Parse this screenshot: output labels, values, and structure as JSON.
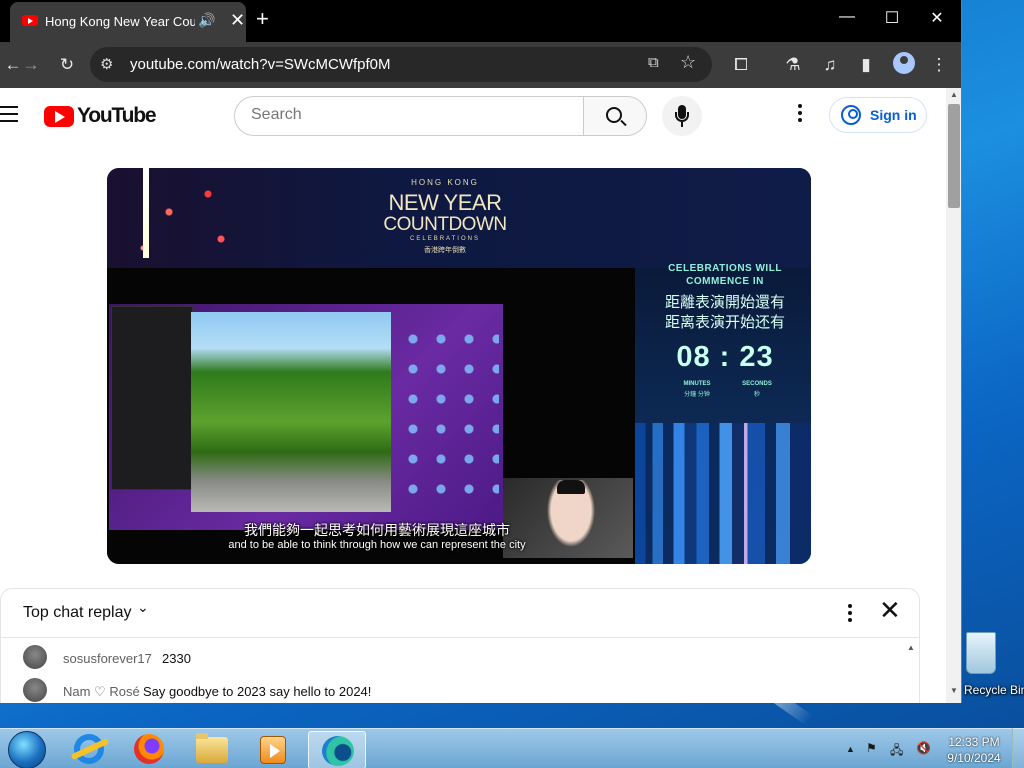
{
  "desktop": {
    "recycle_bin_label": "Recycle Bin"
  },
  "browser": {
    "tab_title": "Hong Kong New Year Countdown",
    "url": "youtube.com/watch?v=SWcMCWfpf0M",
    "new_tab_glyph": "+",
    "controls": {
      "minimize": "—",
      "maximize": "☐",
      "close": "✕"
    },
    "icons": [
      "back-icon",
      "forward-icon",
      "reload-icon",
      "tune-icon",
      "cast-icon",
      "star-icon",
      "extensions-icon",
      "labs-icon",
      "media-icon",
      "sidepanel-icon",
      "profile-icon",
      "menu-icon"
    ]
  },
  "youtube": {
    "logo_text": "YouTube",
    "search_placeholder": "Search",
    "sign_in_label": "Sign in"
  },
  "video": {
    "brand_top": "HONG KONG",
    "brand_line1": "NEW YEAR",
    "brand_line2": "COUNTDOWN",
    "brand_sub": "CELEBRATIONS",
    "brand_zh": "香港跨年倒數",
    "countdown_en1": "CELEBRATIONS WILL",
    "countdown_en2": "COMMENCE IN",
    "countdown_zh_trad": "距離表演開始還有",
    "countdown_zh_simp": "距离表演开始还有",
    "countdown_time": "08 : 23",
    "minutes_label": "MINUTES",
    "seconds_label": "SECONDS",
    "minutes_zh": "分鐘 分钟",
    "seconds_zh": "秒",
    "subtitle_zh": "我們能夠一起思考如何用藝術展現這座城市",
    "subtitle_en": "and to be able to think through how we can represent the city"
  },
  "chat": {
    "header": "Top chat replay",
    "messages": [
      {
        "author": "sosusforever17",
        "text": "2330"
      },
      {
        "author": "Nam ♡ Rosé",
        "text": "Say goodbye to 2023 say hello to 2024!"
      }
    ]
  },
  "taskbar": {
    "clock_time": "12:33 PM",
    "clock_date": "9/10/2024",
    "apps": [
      "internet-explorer-icon",
      "firefox-icon",
      "file-explorer-icon",
      "media-player-icon",
      "edge-icon"
    ]
  }
}
